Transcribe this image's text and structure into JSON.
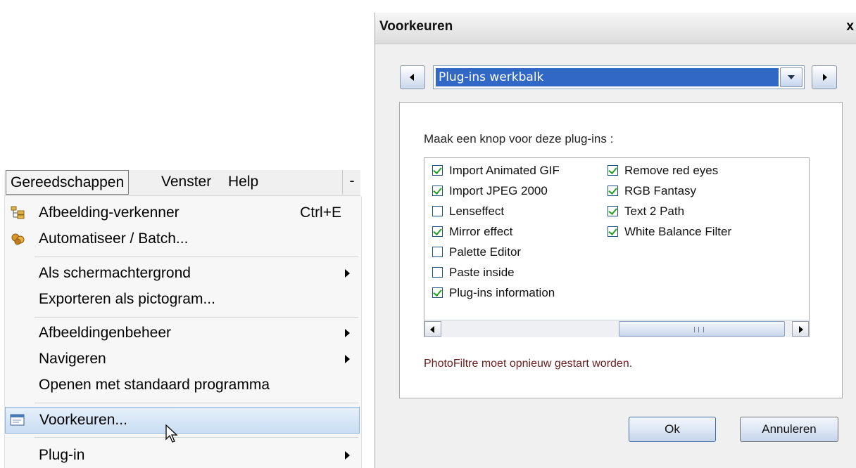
{
  "menubar": {
    "tabs": [
      {
        "label": "Gereedschappen",
        "active": true
      },
      {
        "label": "Venster"
      },
      {
        "label": "Help"
      }
    ],
    "minimize": "-"
  },
  "menu": {
    "items": [
      {
        "label": "Afbeelding-verkenner",
        "shortcut": "Ctrl+E",
        "icon": "folder-tree-icon"
      },
      {
        "label": "Automatiseer / Batch...",
        "icon": "batch-icon"
      },
      {
        "label": "Als schermachtergrond",
        "submenu": true
      },
      {
        "label": "Exporteren als pictogram..."
      },
      {
        "label": "Afbeeldingenbeheer",
        "submenu": true
      },
      {
        "label": "Navigeren",
        "submenu": true
      },
      {
        "label": "Openen met standaard programma"
      },
      {
        "label": "Voorkeuren...",
        "icon": "window-icon",
        "highlighted": true
      },
      {
        "label": "Plug-in",
        "submenu": true
      }
    ]
  },
  "dialog": {
    "title": "Voorkeuren",
    "close": "x",
    "category": "Plug-ins werkbalk",
    "heading": "Maak een knop voor deze plug-ins :",
    "plugins": [
      {
        "label": "Import Animated GIF",
        "checked": true
      },
      {
        "label": "Import JPEG 2000",
        "checked": true
      },
      {
        "label": "Lenseffect",
        "checked": false
      },
      {
        "label": "Mirror effect",
        "checked": true
      },
      {
        "label": "Palette Editor",
        "checked": false
      },
      {
        "label": "Paste inside",
        "checked": false
      },
      {
        "label": "Plug-ins information",
        "checked": true
      },
      {
        "label": "Remove red eyes",
        "checked": true
      },
      {
        "label": "RGB Fantasy",
        "checked": true
      },
      {
        "label": "Text 2 Path",
        "checked": true
      },
      {
        "label": "White Balance Filter",
        "checked": true
      }
    ],
    "warning": "PhotoFiltre moet opnieuw gestart worden.",
    "ok_label": "Ok",
    "cancel_label": "Annuleren"
  },
  "colors": {
    "selection_blue": "#3168c6",
    "check_green": "#21a121",
    "warning_text": "#6a2020"
  }
}
